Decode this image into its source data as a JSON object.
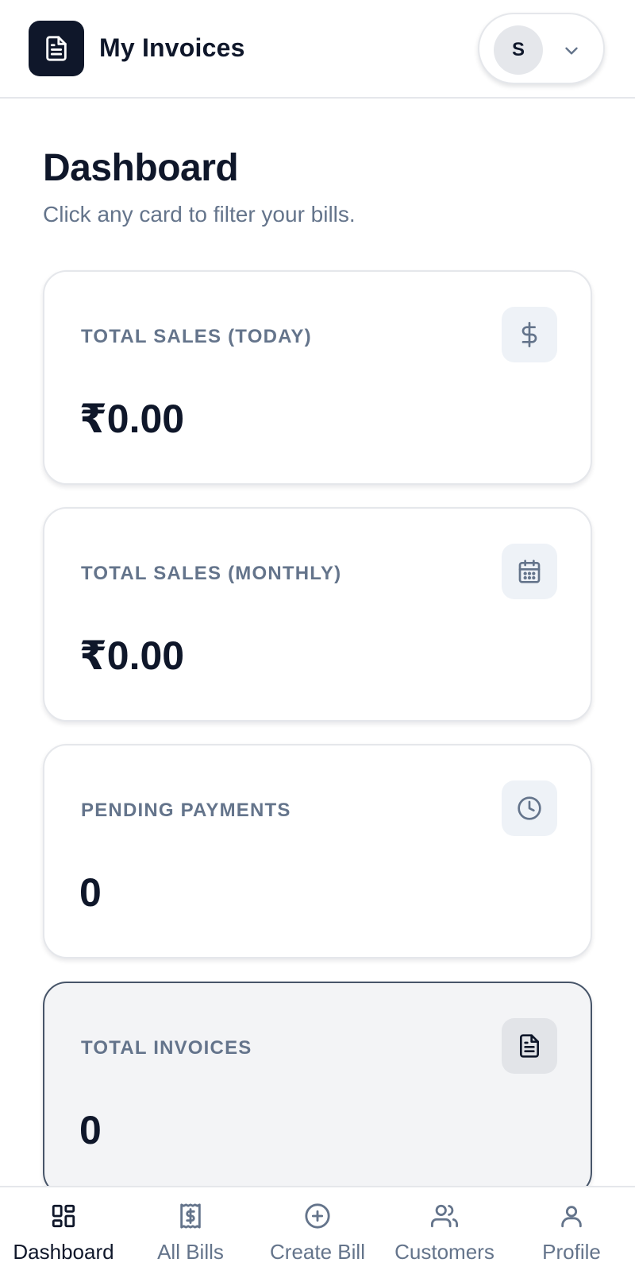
{
  "header": {
    "app_title": "My Invoices",
    "logo_icon": "document-icon",
    "user_initial": "S",
    "menu_icon": "chevron-down-icon"
  },
  "page": {
    "title": "Dashboard",
    "subtitle": "Click any card to filter your bills."
  },
  "cards": [
    {
      "label": "TOTAL SALES (TODAY)",
      "value": "₹0.00",
      "icon": "dollar-icon"
    },
    {
      "label": "TOTAL SALES (MONTHLY)",
      "value": "₹0.00",
      "icon": "calendar-icon"
    },
    {
      "label": "PENDING PAYMENTS",
      "value": "0",
      "icon": "clock-icon"
    },
    {
      "label": "TOTAL INVOICES",
      "value": "0",
      "icon": "document-icon",
      "selected": true
    }
  ],
  "nav": [
    {
      "label": "Dashboard",
      "icon": "grid-icon",
      "active": true
    },
    {
      "label": "All Bills",
      "icon": "receipt-icon"
    },
    {
      "label": "Create Bill",
      "icon": "plus-circle-icon"
    },
    {
      "label": "Customers",
      "icon": "users-icon"
    },
    {
      "label": "Profile",
      "icon": "user-icon"
    }
  ],
  "colors": {
    "primary": "#0f172a",
    "muted": "#64748b",
    "border": "#e5e7eb",
    "icon_bg": "#eef2f7"
  }
}
